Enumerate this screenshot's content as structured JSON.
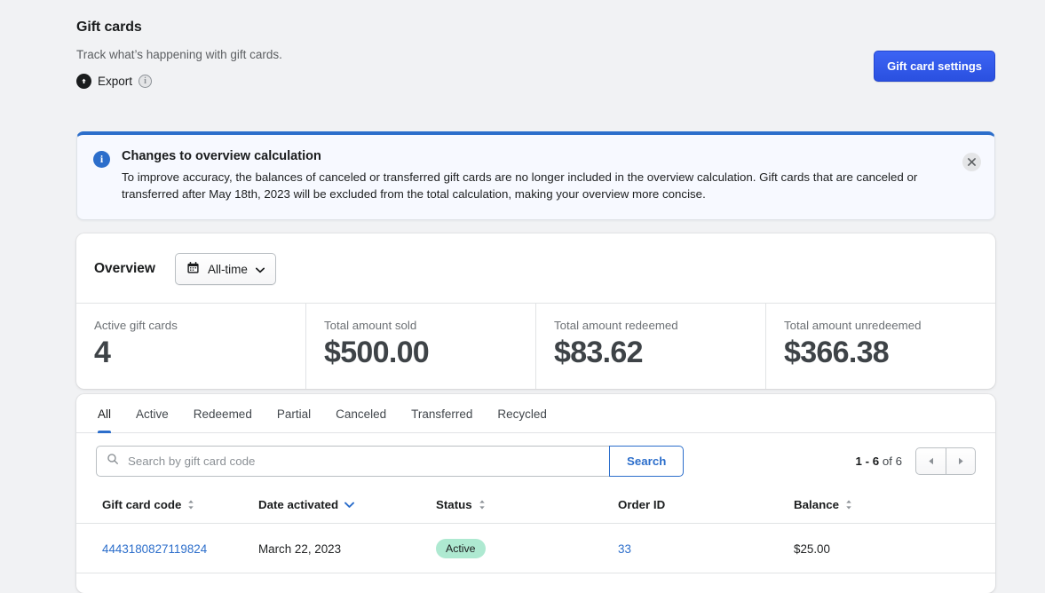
{
  "header": {
    "title": "Gift cards",
    "subtitle": "Track what’s happening with gift cards.",
    "export_label": "Export",
    "export_icon": "upload-circle-icon",
    "info_icon": "info-icon",
    "settings_button": "Gift card settings"
  },
  "banner": {
    "icon": "info-icon",
    "title": "Changes to overview calculation",
    "text": "To improve accuracy, the balances of canceled or transferred gift cards are no longer included in the overview calculation. Gift cards that are canceled or transferred after May 18th, 2023 will be excluded from the total calculation, making your overview more concise.",
    "close_icon": "close-icon",
    "accent_color": "#2c6ecb",
    "background_color": "#f7f9ff"
  },
  "overview": {
    "label": "Overview",
    "date_range": "All-time",
    "calendar_icon": "calendar-icon",
    "chevron_icon": "chevron-down-icon",
    "metrics": [
      {
        "label": "Active gift cards",
        "value": "4"
      },
      {
        "label": "Total amount sold",
        "value": "$500.00"
      },
      {
        "label": "Total amount redeemed",
        "value": "$83.62"
      },
      {
        "label": "Total amount unredeemed",
        "value": "$366.38"
      }
    ]
  },
  "tabs": {
    "items": [
      {
        "label": "All",
        "active": true
      },
      {
        "label": "Active",
        "active": false
      },
      {
        "label": "Redeemed",
        "active": false
      },
      {
        "label": "Partial",
        "active": false
      },
      {
        "label": "Canceled",
        "active": false
      },
      {
        "label": "Transferred",
        "active": false
      },
      {
        "label": "Recycled",
        "active": false
      }
    ],
    "active_color": "#2c6ecb"
  },
  "search": {
    "placeholder": "Search by gift card code",
    "value": "",
    "search_icon": "search-icon",
    "button_label": "Search"
  },
  "pagination": {
    "range": "1 - 6",
    "of_text": "of 6",
    "prev_icon": "chevron-left-icon",
    "next_icon": "chevron-right-icon"
  },
  "table": {
    "columns": [
      {
        "label": "Gift card code",
        "sort": "both"
      },
      {
        "label": "Date activated",
        "sort": "desc-active"
      },
      {
        "label": "Status",
        "sort": "both"
      },
      {
        "label": "Order ID",
        "sort": "none"
      },
      {
        "label": "Balance",
        "sort": "both"
      }
    ],
    "rows": [
      {
        "code": "4443180827119824",
        "date_activated": "March 22, 2023",
        "status": "Active",
        "status_color": "#aee9d1",
        "order_id": "33",
        "balance": "$25.00"
      }
    ]
  }
}
